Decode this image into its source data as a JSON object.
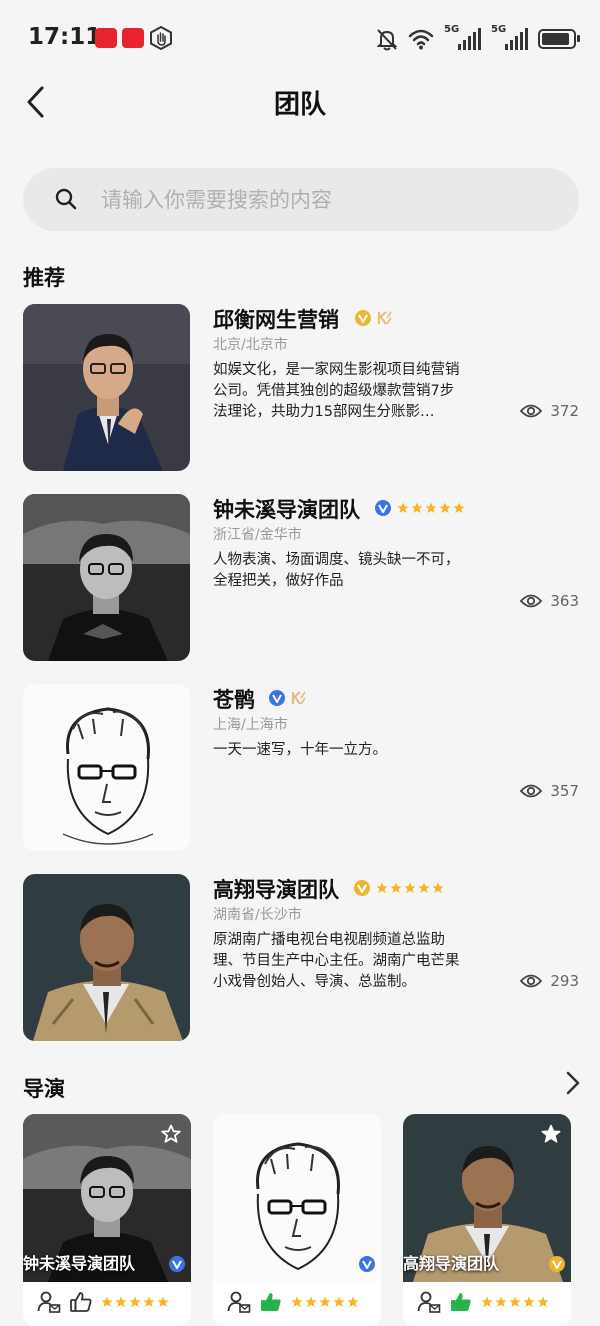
{
  "status_bar": {
    "time": "17:11",
    "network_1": "5G",
    "network_2": "5G"
  },
  "header": {
    "title": "团队"
  },
  "search": {
    "placeholder": "请输入你需要搜索的内容"
  },
  "recommend": {
    "title": "推荐",
    "items": [
      {
        "name": "邱衡网生营销",
        "badge": "gold-v-icon",
        "location": "北京/北京市",
        "description": "如娱文化，是一家网生影视项目纯营销公司。凭借其独创的超级爆款营销7步法理论，共助力15部网生分账影…",
        "views": "372"
      },
      {
        "name": "钟未溪导演团队",
        "badge": "blue-v-icon",
        "rating": 5,
        "location": "浙江省/金华市",
        "description": "人物表演、场面调度、镜头缺一不可，全程把关，做好作品",
        "views": "363"
      },
      {
        "name": "苍鹘",
        "badge": "blue-v-icon",
        "location": "上海/上海市",
        "description": "一天一速写，十年一立方。",
        "views": "357"
      },
      {
        "name": "高翔导演团队",
        "badge": "gold-v-icon",
        "rating": 5,
        "location": "湖南省/长沙市",
        "description": "原湖南广播电视台电视剧频道总监助理、节目生产中心主任。湖南广电芒果小戏骨创始人、导演、总监制。",
        "views": "293"
      }
    ]
  },
  "directors": {
    "title": "导演",
    "cards": [
      {
        "name": "钟未溪导演团队",
        "rating": 5
      },
      {
        "name": "",
        "rating": 5
      },
      {
        "name": "高翔导演团队",
        "rating": 5
      }
    ]
  },
  "colors": {
    "gold": "#eab830",
    "blue": "#3b73e6",
    "like_green": "#27b24a",
    "star": "#f5b623"
  }
}
